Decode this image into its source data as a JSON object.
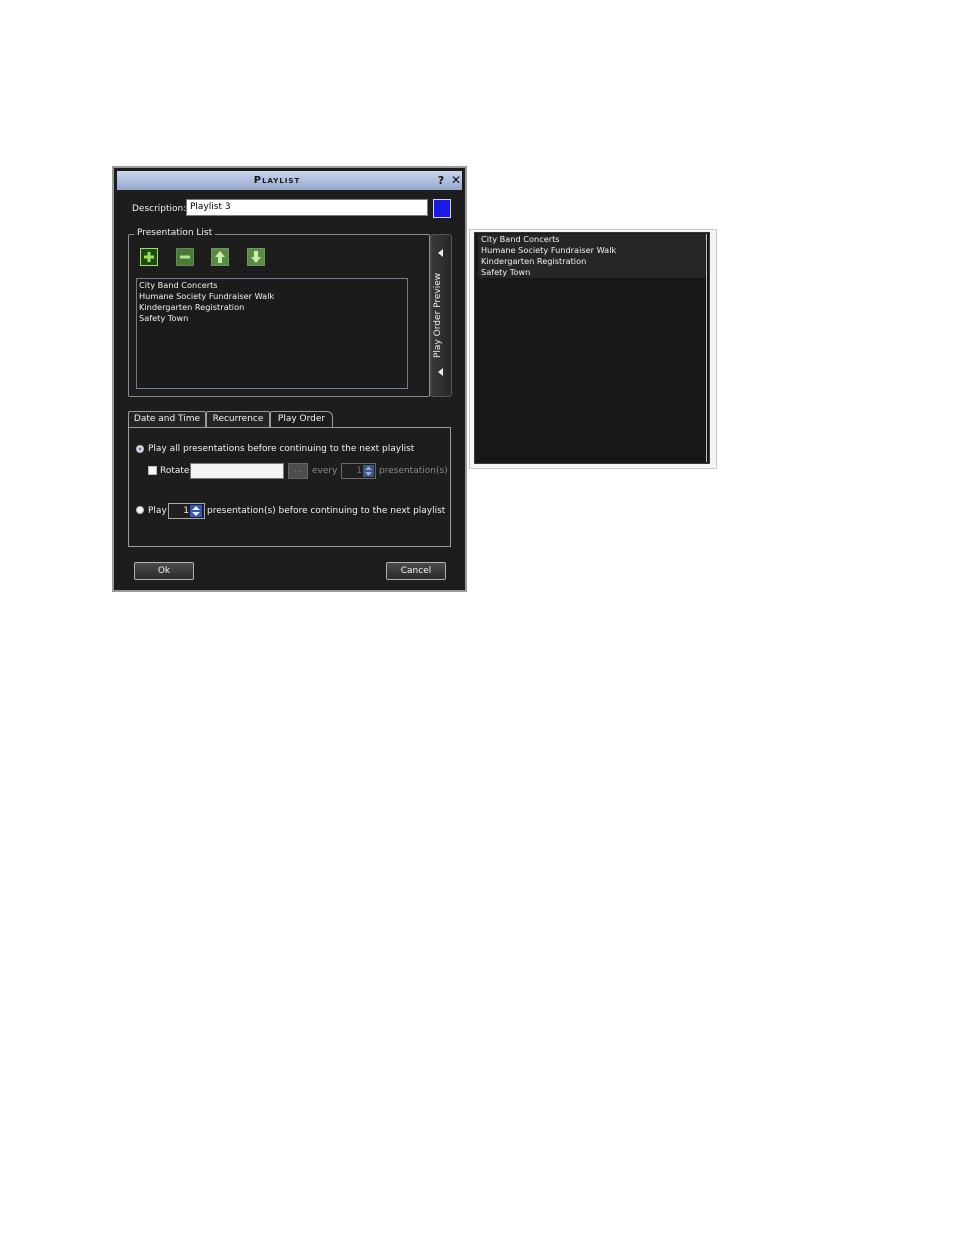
{
  "dialog": {
    "title": "Playlist",
    "help_label": "?",
    "close_label": "✕",
    "description_label": "Description:",
    "description_value": "Playlist 3",
    "color": "#1a1ae6"
  },
  "presentation_list": {
    "legend": "Presentation List",
    "toolbar": [
      "add-icon",
      "remove-icon",
      "move-up-icon",
      "move-down-icon"
    ],
    "items": [
      "City Band Concerts",
      "Humane Society Fundraiser Walk",
      "Kindergarten Registration",
      "Safety Town"
    ],
    "preview_tab_label": "Play Order Preview"
  },
  "tabs": [
    {
      "label": "Date and Time"
    },
    {
      "label": "Recurrence"
    },
    {
      "label": "Play Order",
      "selected": true
    }
  ],
  "play_order": {
    "option_all_label": "Play all presentations before continuing to the next playlist",
    "option_all_selected": true,
    "rotate_label": "Rotate",
    "rotate_checked": false,
    "rotate_value": "",
    "browse_label": "...",
    "every_label": "every",
    "rotate_count": "1",
    "presentations_suffix": "presentation(s)",
    "option_play_label": "Play",
    "play_count": "1",
    "play_suffix": "presentation(s) before continuing to the next playlist"
  },
  "buttons": {
    "ok": "Ok",
    "cancel": "Cancel"
  },
  "preview": {
    "items": [
      "City Band Concerts",
      "Humane Society Fundraiser Walk",
      "Kindergarten Registration",
      "Safety Town"
    ]
  }
}
